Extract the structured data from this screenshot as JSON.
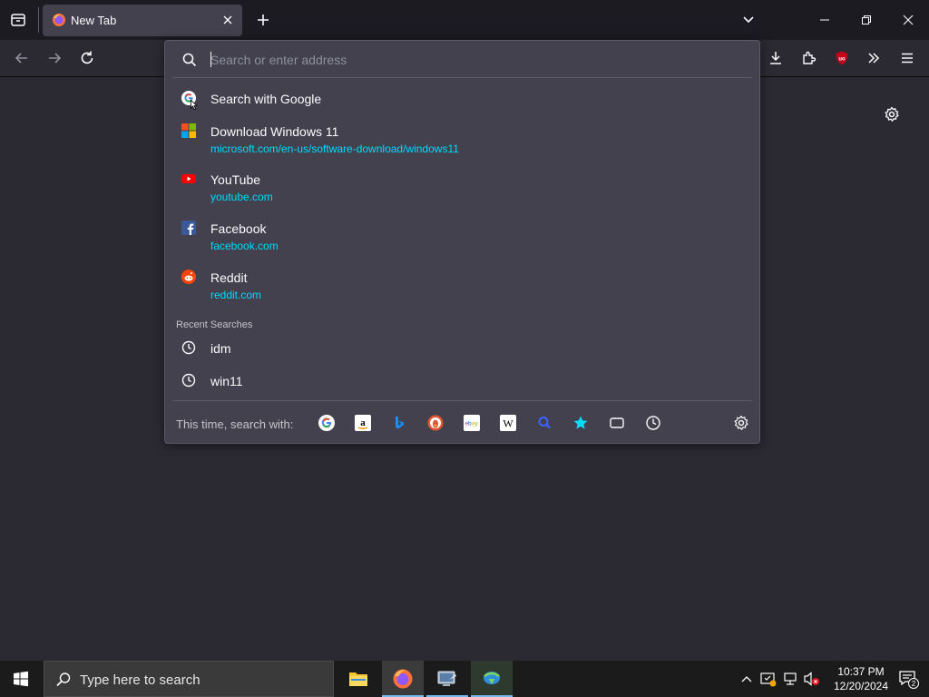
{
  "window": {
    "tab": {
      "title": "New Tab"
    }
  },
  "urlbar": {
    "placeholder": "Search or enter address",
    "suggestions": [
      {
        "title": "Search with Google",
        "url": ""
      },
      {
        "title": "Download Windows 11",
        "url": "microsoft.com/en-us/software-download/windows11"
      },
      {
        "title": "YouTube",
        "url": "youtube.com"
      },
      {
        "title": "Facebook",
        "url": "facebook.com"
      },
      {
        "title": "Reddit",
        "url": "reddit.com"
      }
    ],
    "recent_label": "Recent Searches",
    "recent": [
      "idm",
      "win11"
    ],
    "footer_label": "This time, search with:",
    "engines": [
      "google",
      "amazon",
      "bing",
      "duckduckgo",
      "ebay",
      "wikipedia",
      "search",
      "bookmarks",
      "tabs",
      "history"
    ]
  },
  "taskbar": {
    "search_placeholder": "Type here to search",
    "time": "10:37 PM",
    "date": "12/20/2024",
    "notification_count": "2"
  },
  "colors": {
    "accent_link": "#00ddff",
    "panel_bg": "#42414d",
    "toolbar_bg": "#2b2a33"
  }
}
